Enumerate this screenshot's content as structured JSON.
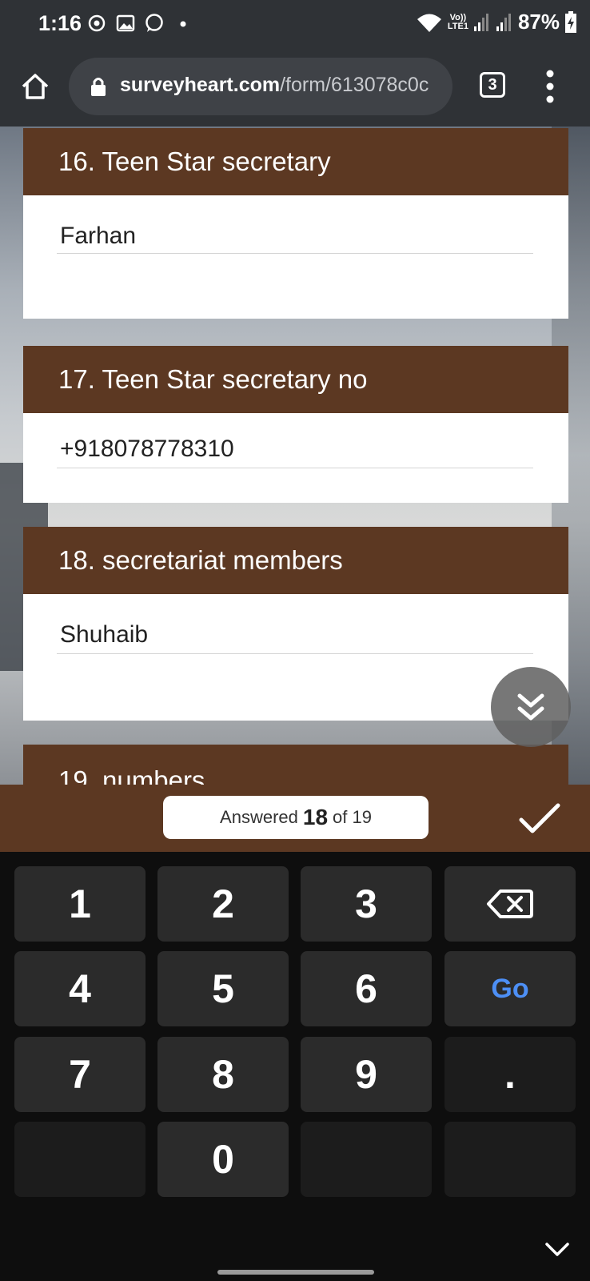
{
  "status_bar": {
    "time": "1:16",
    "network": "Vo))\nLTE1",
    "battery": "87%"
  },
  "browser": {
    "url_domain": "surveyheart.com",
    "url_path": "/form/613078c0c",
    "tab_count": "3"
  },
  "questions": [
    {
      "title": "16. Teen Star secretary",
      "answer": "Farhan"
    },
    {
      "title": "17. Teen Star secretary no",
      "answer": "+918078778310"
    },
    {
      "title": "18. secretariat members",
      "answer": "Shuhaib"
    },
    {
      "title": "19. numbers",
      "answer": ""
    }
  ],
  "progress": {
    "prefix": "Answered",
    "answered": "18",
    "suffix": "of 19"
  },
  "keyboard": {
    "keys": [
      "1",
      "2",
      "3",
      "4",
      "5",
      "6",
      "7",
      "8",
      "9",
      "0"
    ],
    "go": "Go",
    "dot": "."
  },
  "colors": {
    "header_brown": "#5c3822",
    "status_bar": "#2f3236",
    "go_blue": "#4d8ff5"
  }
}
